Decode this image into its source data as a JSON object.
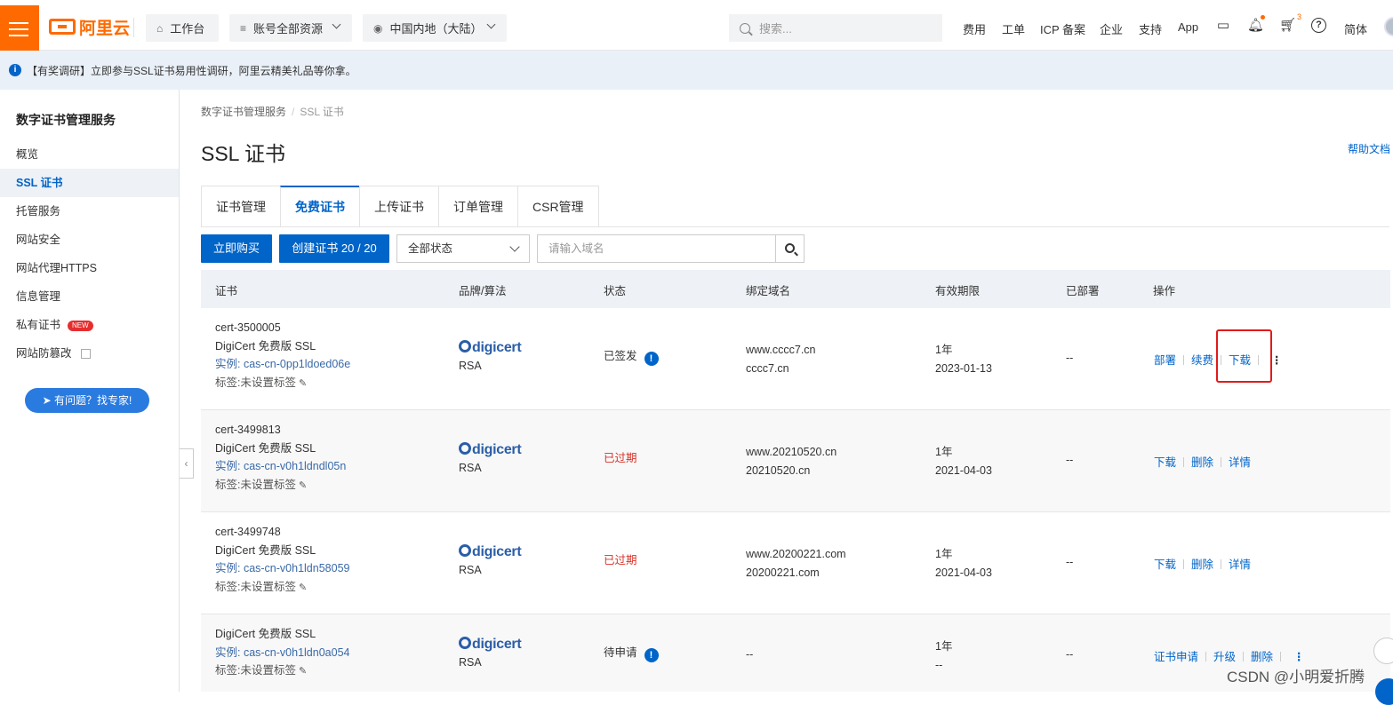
{
  "topbar": {
    "brand": "阿里云",
    "workbench": "工作台",
    "resources": "账号全部资源",
    "region": "中国内地（大陆）",
    "search_placeholder": "搜索...",
    "links": {
      "fee": "费用",
      "ticket": "工单",
      "icp": "ICP 备案",
      "enterprise": "企业",
      "support": "支持",
      "app": "App",
      "lang": "简体"
    },
    "cart_count": "3"
  },
  "notice": {
    "text": "【有奖调研】立即参与SSL证书易用性调研，阿里云精美礼品等你拿。"
  },
  "sidebar": {
    "title": "数字证书管理服务",
    "items": [
      "概览",
      "SSL 证书",
      "托管服务",
      "网站安全",
      "网站代理HTTPS",
      "信息管理",
      "私有证书",
      "网站防篡改"
    ],
    "new_badge": "NEW",
    "expert_button": "有问题？找专家!"
  },
  "breadcrumb": {
    "root": "数字证书管理服务",
    "current": "SSL 证书"
  },
  "page": {
    "title": "SSL 证书",
    "help_doc": "帮助文档"
  },
  "tabs": [
    "证书管理",
    "免费证书",
    "上传证书",
    "订单管理",
    "CSR管理"
  ],
  "toolbar": {
    "buy": "立即购买",
    "create": "创建证书 20 / 20",
    "status_select": "全部状态",
    "domain_placeholder": "请输入域名"
  },
  "table": {
    "headers": [
      "证书",
      "品牌/算法",
      "状态",
      "绑定域名",
      "有效期限",
      "已部署",
      "操作"
    ],
    "rows": [
      {
        "cert_id": "cert-3500005",
        "product": "DigiCert 免费版 SSL",
        "instance": "实例: cas-cn-0pp1ldoed06e",
        "tag": "标签:未设置标签",
        "brand": "digicert",
        "algo": "RSA",
        "status": "已签发",
        "domains": [
          "www.cccc7.cn",
          "cccc7.cn"
        ],
        "validity": "1年",
        "expire": "2023-01-13",
        "deployed": "--",
        "ops": [
          "部署",
          "续费",
          "下载"
        ]
      },
      {
        "cert_id": "cert-3499813",
        "product": "DigiCert 免费版 SSL",
        "instance": "实例: cas-cn-v0h1ldndl05n",
        "tag": "标签:未设置标签",
        "brand": "digicert",
        "algo": "RSA",
        "status": "已过期",
        "domains": [
          "www.20210520.cn",
          "20210520.cn"
        ],
        "validity": "1年",
        "expire": "2021-04-03",
        "deployed": "--",
        "ops": [
          "下载",
          "删除",
          "详情"
        ]
      },
      {
        "cert_id": "cert-3499748",
        "product": "DigiCert 免费版 SSL",
        "instance": "实例: cas-cn-v0h1ldn58059",
        "tag": "标签:未设置标签",
        "brand": "digicert",
        "algo": "RSA",
        "status": "已过期",
        "domains": [
          "www.20200221.com",
          "20200221.com"
        ],
        "validity": "1年",
        "expire": "2021-04-03",
        "deployed": "--",
        "ops": [
          "下载",
          "删除",
          "详情"
        ]
      },
      {
        "cert_id": "",
        "product": "DigiCert 免费版 SSL",
        "instance": "实例: cas-cn-v0h1ldn0a054",
        "tag": "标签:未设置标签",
        "brand": "digicert",
        "algo": "RSA",
        "status": "待申请",
        "domains": [
          "--",
          ""
        ],
        "validity": "1年",
        "expire": "--",
        "deployed": "--",
        "ops": [
          "证书申请",
          "升级",
          "删除"
        ]
      }
    ]
  },
  "watermark": "CSDN @小明爱折腾"
}
